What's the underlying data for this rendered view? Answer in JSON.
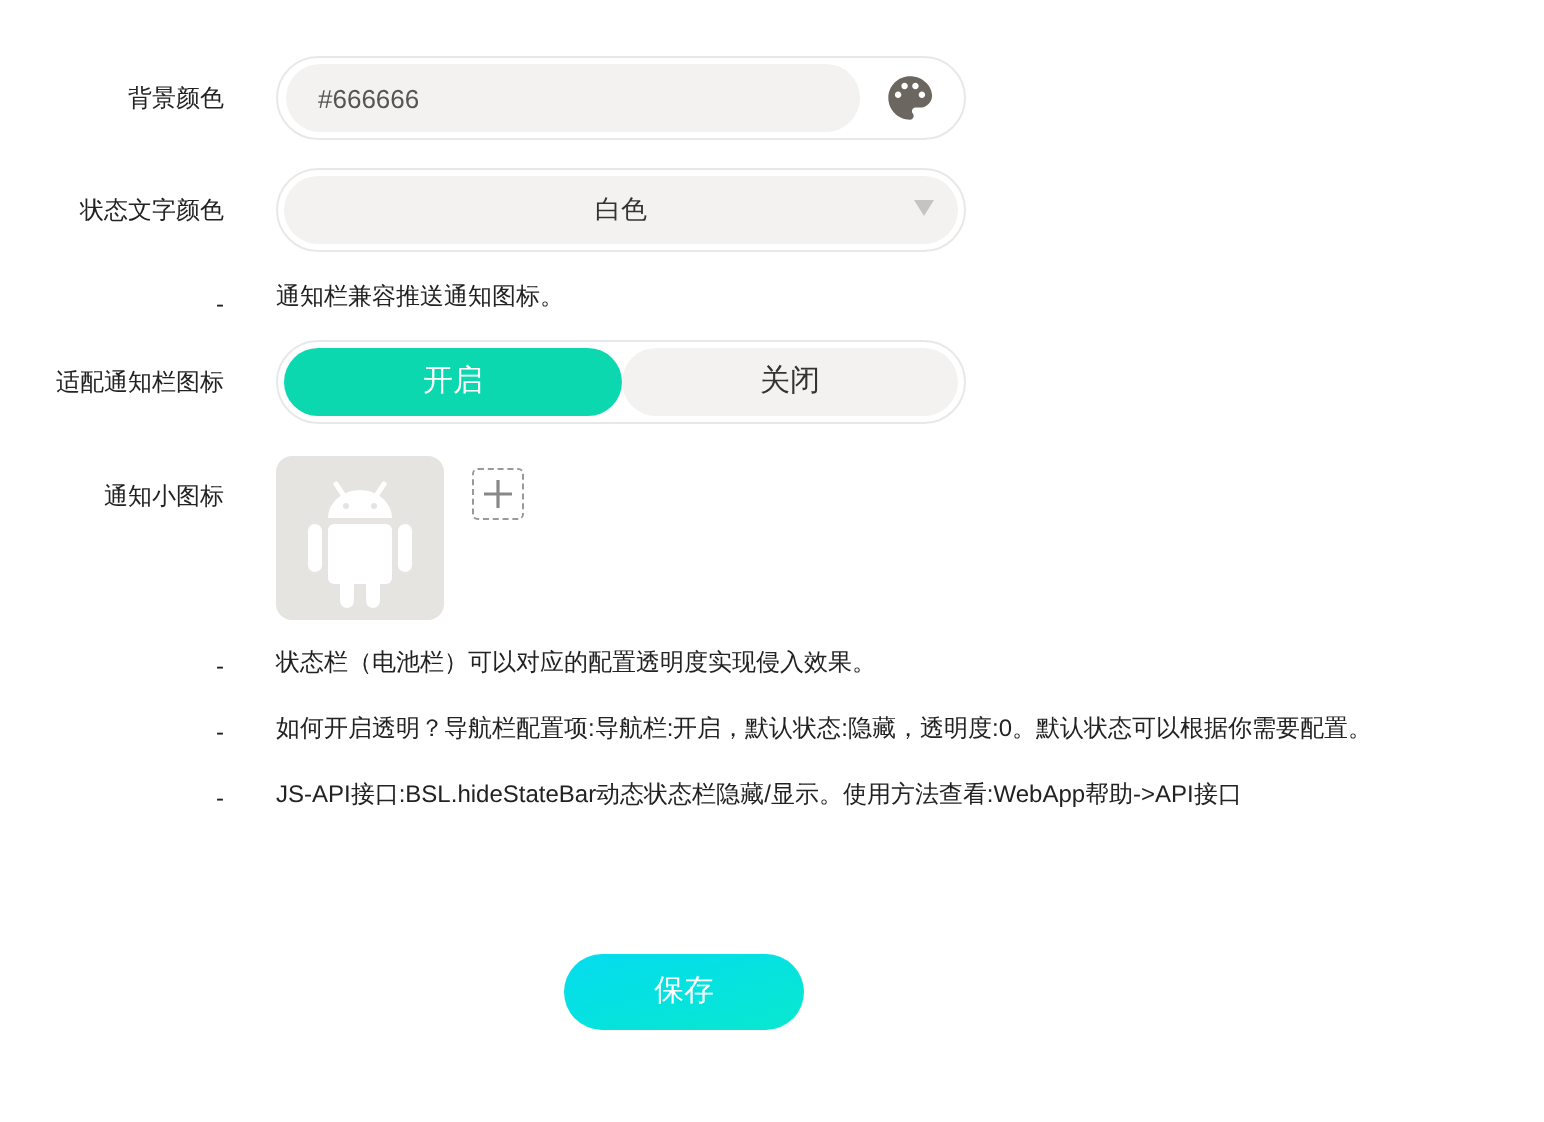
{
  "fields": [
    {
      "kind": "color",
      "label": "背景颜色",
      "value": "#666666"
    },
    {
      "kind": "select",
      "label": "状态文字颜色",
      "value": "白色"
    },
    {
      "kind": "hint",
      "label": "-",
      "text": "通知栏兼容推送通知图标。"
    },
    {
      "kind": "toggle",
      "label": "适配通知栏图标",
      "options": [
        {
          "label": "开启",
          "selected": true
        },
        {
          "label": "关闭",
          "selected": false
        }
      ]
    },
    {
      "kind": "icon_upload",
      "label": "通知小图标"
    },
    {
      "kind": "hint",
      "label": "-",
      "text": "状态栏（电池栏）可以对应的配置透明度实现侵入效果。"
    },
    {
      "kind": "hint",
      "label": "-",
      "text": "如何开启透明？导航栏配置项:导航栏:开启，默认状态:隐藏，透明度:0。默认状态可以根据你需要配置。"
    },
    {
      "kind": "hint",
      "label": "-",
      "text": "JS-API接口:BSL.hideStateBar动态状态栏隐藏/显示。使用方法查看:WebApp帮助->API接口"
    }
  ],
  "save_button": "保存"
}
